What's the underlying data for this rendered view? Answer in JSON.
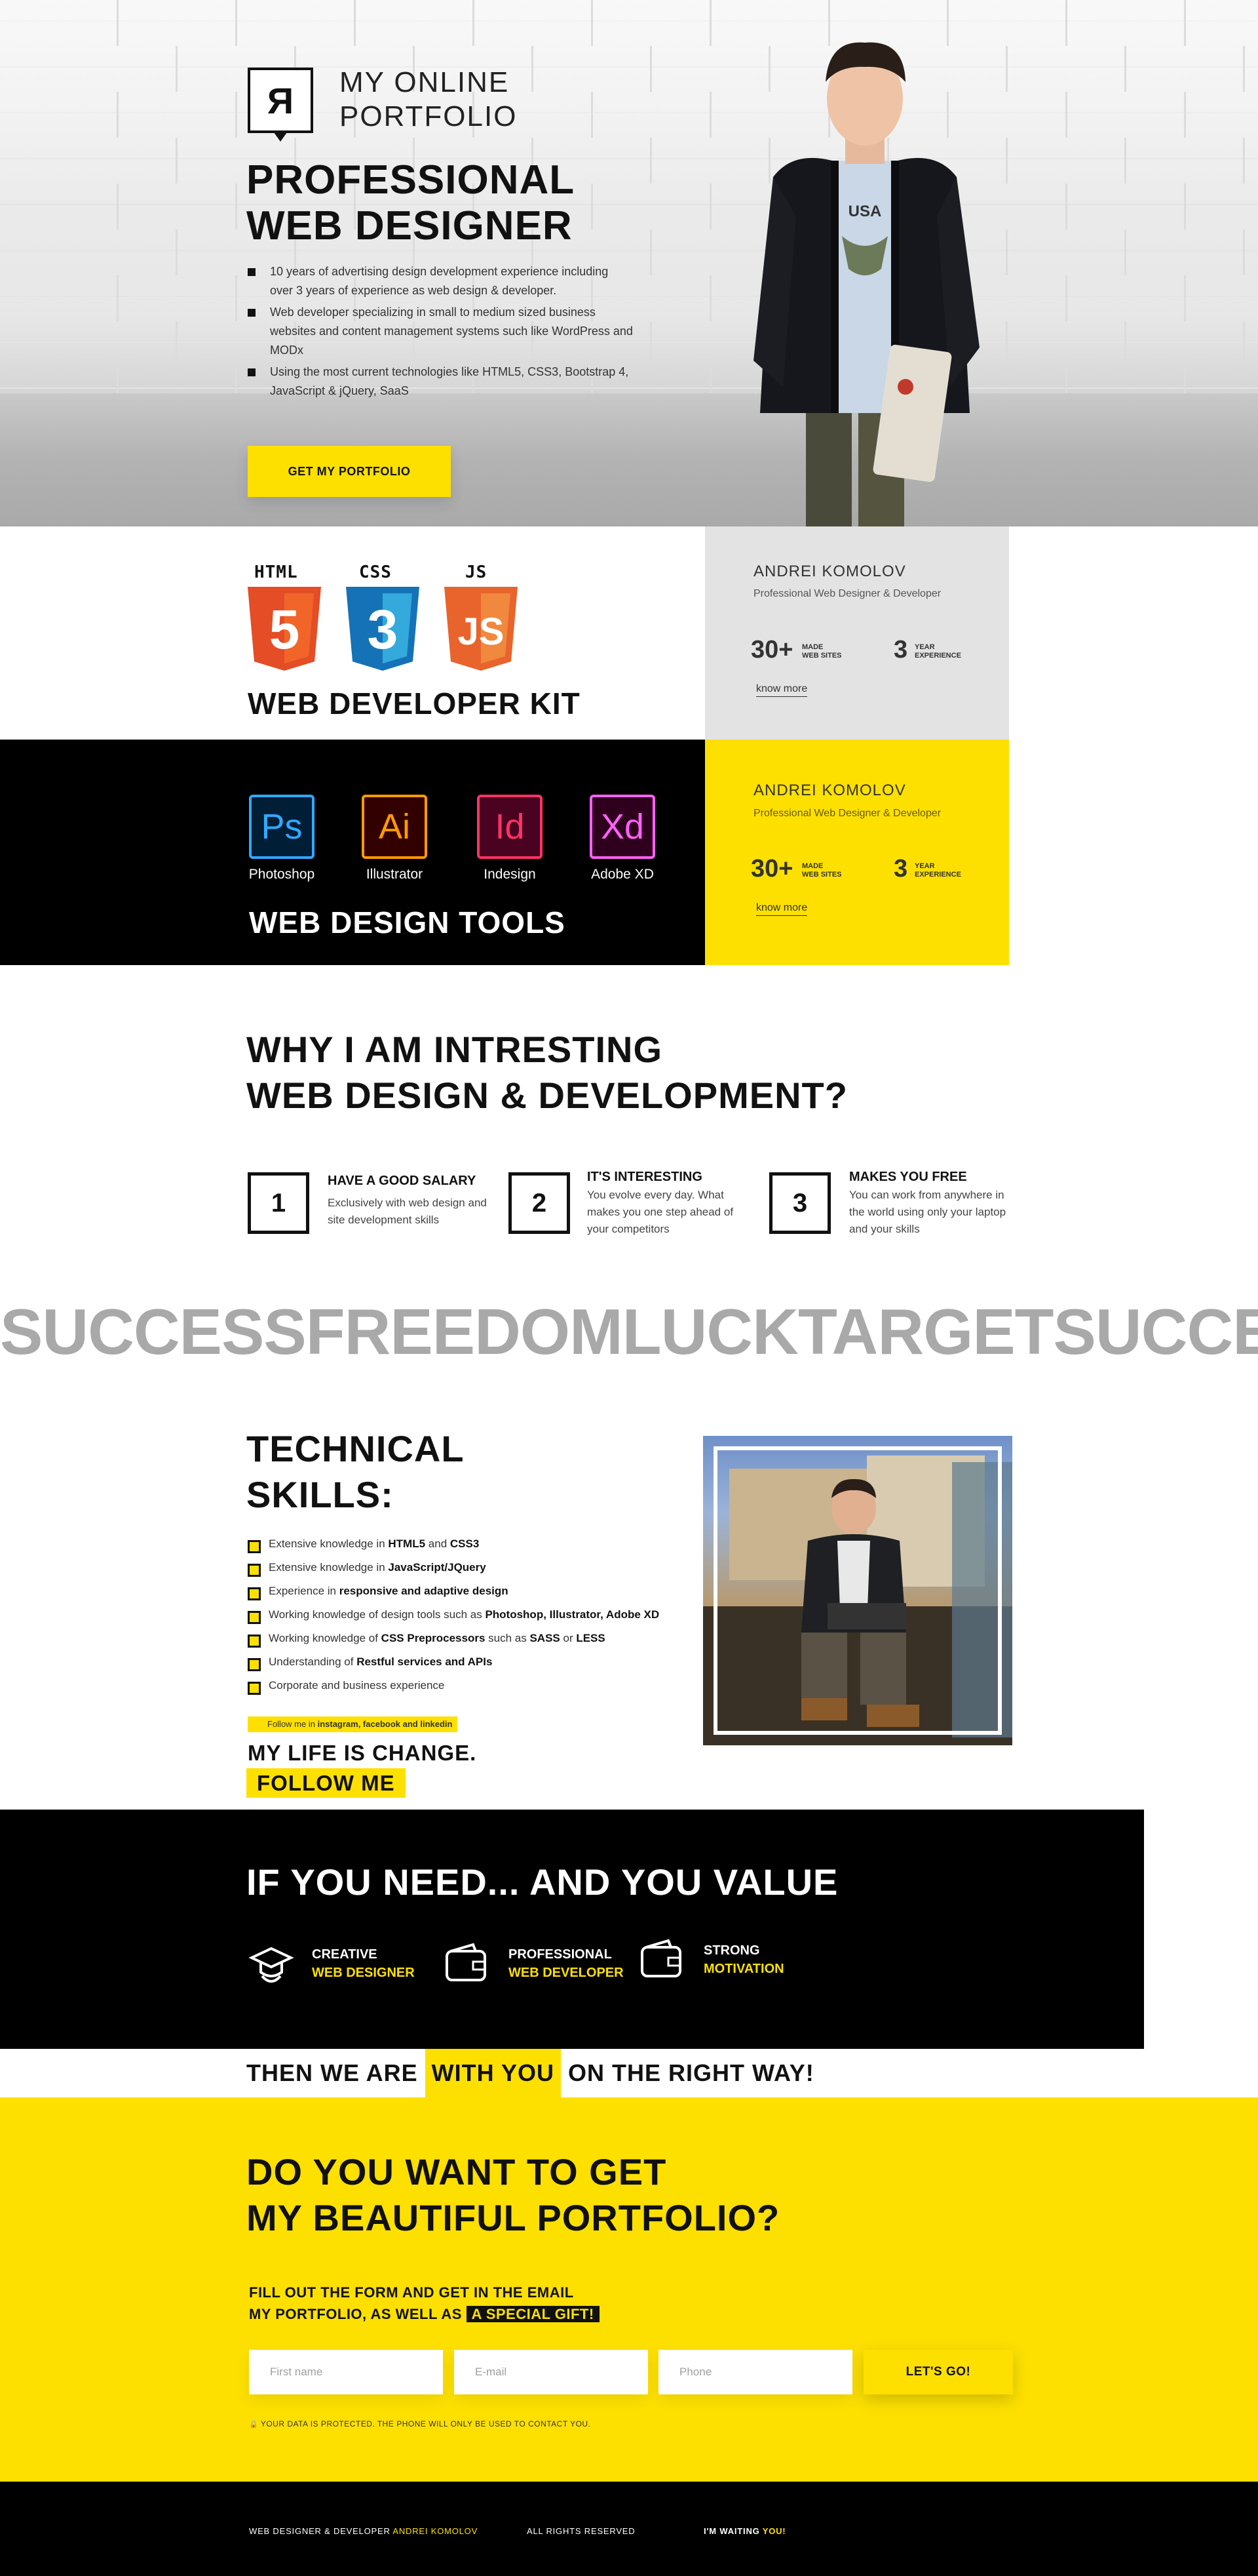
{
  "hero": {
    "logo_letter": "Я",
    "logo_line1": "MY ONLINE",
    "logo_line2": "PORTFOLIO",
    "title_line1": "PROFESSIONAL",
    "title_line2": "WEB DESIGNER",
    "bullets": [
      "10 years of advertising design development experience including over 3 years of experience as web design & developer.",
      "Web developer specializing in small to medium sized business websites and content management systems such like WordPress and MODx",
      "Using the most current technologies like HTML5, CSS3, Bootstrap 4, JavaScript & jQuery, SaaS"
    ],
    "cta_label": "GET MY PORTFOLIO",
    "shirt_text": "USA"
  },
  "kit": {
    "badges": [
      {
        "label": "HTML",
        "glyph": "5",
        "color": "#e44d26",
        "dark": "#f16529"
      },
      {
        "label": "CSS",
        "glyph": "3",
        "color": "#1572b6",
        "dark": "#33a9dc"
      },
      {
        "label": "JS",
        "glyph": "JS",
        "color": "#e9642c",
        "dark": "#f0883e"
      }
    ],
    "title": "WEB DEVELOPER KIT",
    "card": {
      "name": "ANDREI KOMOLOV",
      "sub": "Professional Web Designer & Developer",
      "num1": "30+",
      "num1_l1": "MADE",
      "num1_l2": "WEB SITES",
      "num2": "3",
      "num2_l1": "YEAR",
      "num2_l2": "EXPERIENCE",
      "link": "know more"
    }
  },
  "tools": {
    "items": [
      {
        "glyph": "Ps",
        "label": "Photoshop",
        "color": "#31a8ff",
        "bg": "#001e36"
      },
      {
        "glyph": "Ai",
        "label": "Illustrator",
        "color": "#ff9a00",
        "bg": "#330000"
      },
      {
        "glyph": "Id",
        "label": "Indesign",
        "color": "#ff3366",
        "bg": "#49021f"
      },
      {
        "glyph": "Xd",
        "label": "Adobe XD",
        "color": "#ff61f6",
        "bg": "#2e001e"
      }
    ],
    "title": "WEB DESIGN TOOLS",
    "card": {
      "name": "ANDREI KOMOLOV",
      "sub": "Professional Web Designer & Developer",
      "num1": "30+",
      "num1_l1": "MADE",
      "num1_l2": "WEB SITES",
      "num2": "3",
      "num2_l1": "YEAR",
      "num2_l2": "EXPERIENCE",
      "link": "know more"
    }
  },
  "why": {
    "title_line1": "WHY I AM INTRESTING",
    "title_line2": "WEB DESIGN & DEVELOPMENT?",
    "items": [
      {
        "num": "1",
        "heading": "HAVE A GOOD SALARY",
        "text": "Exclusively with web design and site development skills"
      },
      {
        "num": "2",
        "heading": "IT'S INTERESTING",
        "text": "You evolve every day. What makes you one step ahead of your competitors"
      },
      {
        "num": "3",
        "heading": "MAKES YOU FREE",
        "text": "You can work from anywhere in the world using only your laptop and your skills"
      }
    ]
  },
  "ticker": "SUCCESSFREEDOMLUCKTARGETSUCCESSFREEDOM",
  "tech": {
    "title_line1": "TECHNICAL",
    "title_line2": "SKILLS:",
    "skills": [
      {
        "pre": "Extensive knowledge in ",
        "b1": "HTML5",
        "mid": " and ",
        "b2": "CSS3",
        "post": ""
      },
      {
        "pre": "Extensive knowledge in ",
        "b1": "JavaScript/JQuery",
        "mid": "",
        "b2": "",
        "post": ""
      },
      {
        "pre": "Experience in ",
        "b1": "responsive and adaptive design",
        "mid": "",
        "b2": "",
        "post": ""
      },
      {
        "pre": "Working knowledge of design tools such as ",
        "b1": "Photoshop, Illustrator, Adobe XD",
        "mid": "",
        "b2": "",
        "post": ""
      },
      {
        "pre": "Working knowledge of ",
        "b1": "CSS Preprocessors",
        "mid": " such as ",
        "b2": "SASS",
        "post": " or ",
        "b3": "LESS"
      },
      {
        "pre": "Understanding of ",
        "b1": "Restful services and APIs",
        "mid": "",
        "b2": "",
        "post": ""
      },
      {
        "pre": "Corporate and business experience",
        "b1": "",
        "mid": "",
        "b2": "",
        "post": ""
      }
    ],
    "follow_tag_pre": "Follow me in ",
    "follow_tag_bold": "instagram, facebook and linkedin",
    "life_title": "MY LIFE IS CHANGE.",
    "follow_btn": "FOLLOW ME"
  },
  "need": {
    "title": "IF YOU NEED...  AND YOU VALUE",
    "items": [
      {
        "a": "CREATIVE",
        "b": "WEB DESIGNER",
        "icon": "graduate-icon"
      },
      {
        "a": "PROFESSIONAL",
        "b": "WEB DEVELOPER",
        "icon": "wallet-icon"
      },
      {
        "a": "STRONG",
        "b": "MOTIVATION",
        "icon": "wallet-icon"
      }
    ],
    "then_pre": "THEN WE ARE ",
    "then_hl": "WITH YOU",
    "then_post": " ON THE RIGHT WAY!"
  },
  "form": {
    "title_line1": "DO YOU WANT TO GET",
    "title_line2": "MY BEAUTIFUL PORTFOLIO?",
    "lead_line1": "FILL OUT THE FORM AND GET IN THE EMAIL",
    "lead_line2_pre": "MY PORTFOLIO, AS WELL AS ",
    "lead_gift": "A SPECIAL GIFT!",
    "placeholder_name": "First name",
    "placeholder_email": "E-mail",
    "placeholder_phone": "Phone",
    "submit": "LET'S GO!",
    "protect": "YOUR DATA IS PROTECTED. THE PHONE WILL ONLY BE USED TO CONTACT YOU."
  },
  "footer": {
    "left_pre": "WEB DESIGNER & DEVELOPER ",
    "left_name": "ANDREI KOMOLOV",
    "center": "ALL RIGHTS RESERVED",
    "right_pre": "I'M WAITING ",
    "right_hl": "YOU!"
  },
  "colors": {
    "accent": "#fde000",
    "dark": "#000000",
    "card_gray": "#e3e3e3"
  }
}
